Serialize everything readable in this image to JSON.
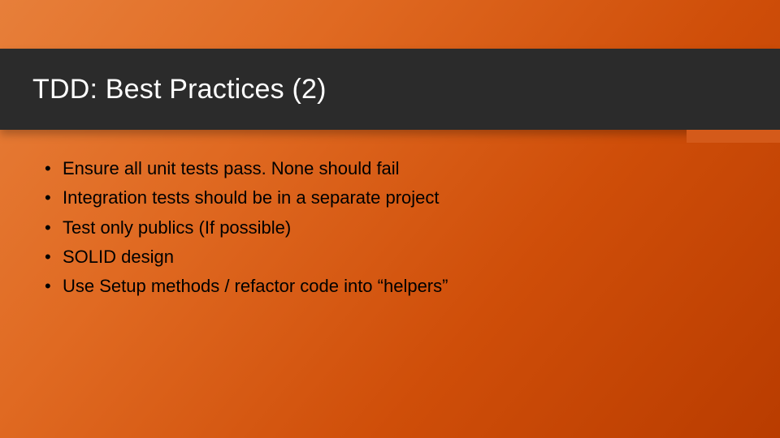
{
  "slide": {
    "title": "TDD: Best Practices (2)",
    "bullets": [
      "Ensure all unit tests pass. None should fail",
      "Integration tests should be in a separate project",
      "Test only publics (If possible)",
      "SOLID design",
      "Use Setup methods / refactor code into “helpers”"
    ]
  }
}
